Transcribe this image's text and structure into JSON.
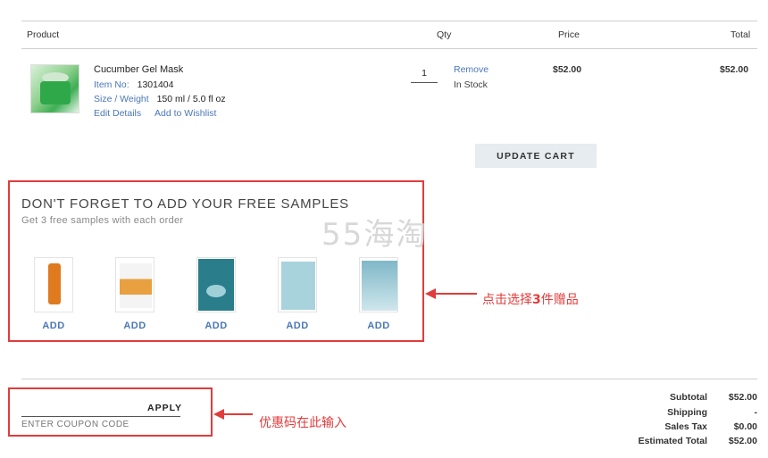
{
  "table": {
    "headers": {
      "product": "Product",
      "qty": "Qty",
      "price": "Price",
      "total": "Total"
    }
  },
  "item": {
    "name": "Cucumber Gel Mask",
    "item_no_label": "Item No:",
    "item_no": "1301404",
    "size_label": "Size / Weight",
    "size": "150 ml / 5.0 fl oz",
    "edit_details": "Edit Details",
    "add_to_wishlist": "Add to Wishlist",
    "qty": "1",
    "remove": "Remove",
    "stock": "In Stock",
    "price": "$52.00",
    "total": "$52.00",
    "image_icon": "product-jar-image"
  },
  "update_cart": "UPDATE CART",
  "samples": {
    "title": "DON'T FORGET TO ADD YOUR FREE SAMPLES",
    "subtitle": "Get 3 free samples with each order",
    "watermark": "55海淘",
    "items": [
      {
        "add": "ADD",
        "color": "#e07a1f"
      },
      {
        "add": "ADD",
        "color": "#e8a040"
      },
      {
        "add": "ADD",
        "color": "#2a7d8a"
      },
      {
        "add": "ADD",
        "color": "#a9d3dc"
      },
      {
        "add": "ADD",
        "color": "#7fb8c8"
      }
    ]
  },
  "annotations": {
    "samples_note_prefix": "点击选择",
    "samples_note_num": "3",
    "samples_note_suffix": "件赠品",
    "coupon_note": "优惠码在此输入",
    "accent": "#e23b3b"
  },
  "coupon": {
    "apply": "APPLY",
    "placeholder": "ENTER COUPON CODE"
  },
  "summary": {
    "subtotal_label": "Subtotal",
    "subtotal": "$52.00",
    "shipping_label": "Shipping",
    "shipping": "-",
    "tax_label": "Sales Tax",
    "tax": "$0.00",
    "est_label": "Estimated Total",
    "est": "$52.00"
  }
}
